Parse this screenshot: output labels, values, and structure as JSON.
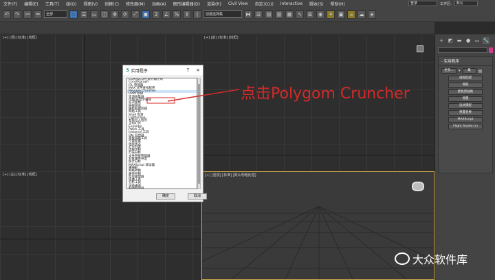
{
  "menubar": {
    "items": [
      "文件(F)",
      "编辑(E)",
      "工具(T)",
      "组(G)",
      "视图(V)",
      "创建(C)",
      "修改器(M)",
      "动画(A)",
      "图形编辑器(D)",
      "渲染(R)",
      "Civil View",
      "自定义(U)",
      "Interactive",
      "脚本(S)",
      "帮助(H)"
    ],
    "search_value": "登录",
    "workspace_label": "工作区:",
    "workspace_value": "默认"
  },
  "toolbar": {
    "selection_filter": "全部",
    "named_selection_placeholder": "创建选择集"
  },
  "viewports": {
    "top_left_label": "[+] [顶] [标准] [线框]",
    "top_right_label": "[+] [前] [标准] [线框]",
    "bottom_left_label": "[+] [左] [标准] [线框]",
    "bottom_right_label": "[+] [透视] [标准] [默认明暗处理]"
  },
  "command_panel": {
    "rollout_title": "- 实用程序",
    "more_button": "更多...",
    "sets_button": "集",
    "buttons": [
      "透视匹配",
      "塌陷",
      "颜色剪贴板",
      "测量",
      "运动捕捉",
      "重置变换",
      "MAXScript",
      "Flight Studio (c)"
    ]
  },
  "dialog": {
    "title": "实用程序",
    "help": "?",
    "close": "×",
    "items": [
      "COM/DCOM 服务器控制",
      "ConstRgraph",
      "IFL 管理器",
      "MAX 文件查找程序",
      "Polygon Cruncher",
      "UVW 移除",
      "资源收集器",
      "位图/光度学路径",
      "层次面板",
      "链接继承",
      "摄影机跟踪器",
      "网格工具",
      "Shell 资源",
      "Lightscape",
      "材质导入程序",
      "全局灯光",
      "Exploder",
      "Patch 工具",
      "Instance 工具",
      "Obj 导出器",
      "面板辅助工具",
      "引擎配置",
      "场景状态",
      "灯光列表",
      "选择流程",
      "灯光分析",
      "文件链接管理器",
      "对象属性导出",
      "统计分析",
      "MAXScript 调试器",
      "重映射",
      "网格转换",
      "路径控制",
      "反应管理器",
      "扭曲工具",
      "分析工具",
      "渲染通道",
      "贴图缩放器",
      "塌陷",
      "重置变换"
    ],
    "selected_index": 4,
    "ok_button": "确定",
    "cancel_button": "取消"
  },
  "annotation": {
    "text": "点击Polygom Cruncher"
  },
  "watermark": {
    "text": "大众软件库"
  },
  "colors": {
    "annotation_red": "#d42a2a",
    "active_viewport_border": "#d6b24a",
    "ui_gray": "#444444"
  }
}
